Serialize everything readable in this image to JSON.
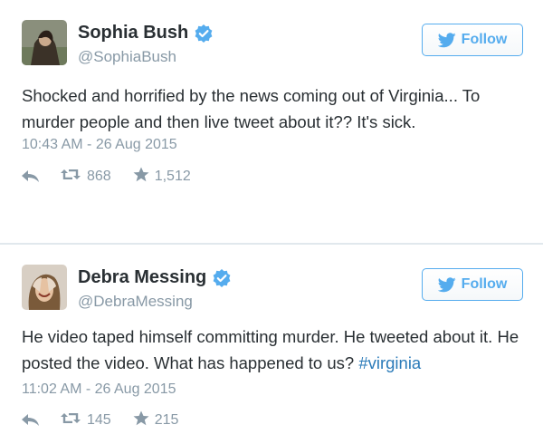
{
  "tweets": [
    {
      "name": "Sophia Bush",
      "handle": "@SophiaBush",
      "follow_label": "Follow",
      "text": "Shocked and horrified by the news coming out of Virginia... To murder people and then live tweet about it?? It's sick.",
      "hashtag": "",
      "timestamp": "10:43 AM - 26 Aug 2015",
      "retweets": "868",
      "likes": "1,512",
      "avatar_icon": "profile-photo"
    },
    {
      "name": "Debra Messing",
      "handle": "@DebraMessing",
      "follow_label": "Follow",
      "text": "He video taped himself committing murder. He tweeted about it. He posted the video. What has happened to us? ",
      "hashtag": "#virginia",
      "timestamp": "11:02 AM - 26 Aug 2015",
      "retweets": "145",
      "likes": "215",
      "avatar_icon": "profile-photo"
    }
  ],
  "colors": {
    "accent": "#55acee",
    "link": "#2b7bb9",
    "muted": "#8899a6",
    "text": "#292f33",
    "divider": "#e1e8ed"
  },
  "icons": [
    "verified-badge-icon",
    "twitter-bird-icon",
    "reply-icon",
    "retweet-icon",
    "star-icon"
  ]
}
